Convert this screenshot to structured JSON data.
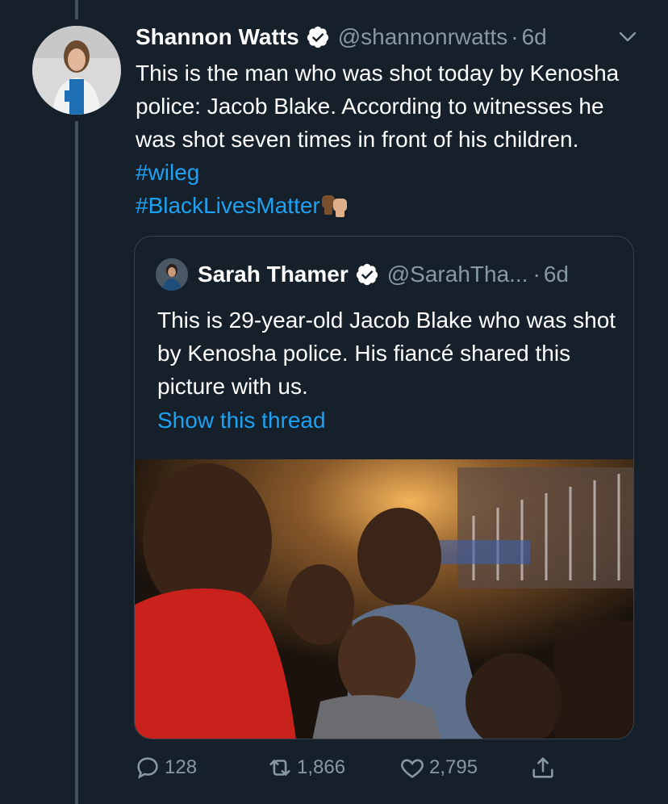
{
  "tweet": {
    "author_name": "Shannon Watts",
    "handle": "@shannonrwatts",
    "separator": "·",
    "time": "6d",
    "text_plain": "This is the man who was shot today by Kenosha police: Jacob Blake. According to witnesses he was shot seven times in front of his children.",
    "hashtag_1": "#wileg",
    "hashtag_2": "#BlackLivesMatter",
    "emoji": "raised-fists-emoji"
  },
  "quoted_tweet": {
    "author_name": "Sarah Thamer",
    "handle": "@SarahTha...",
    "separator": "·",
    "time": "6d",
    "text": "This is 29-year-old Jacob Blake who was shot by Kenosha police. His fiancé shared this picture with us.",
    "show_thread": "Show this thread"
  },
  "actions": {
    "replies": "128",
    "retweets": "1,866",
    "likes": "2,795"
  },
  "colors": {
    "background": "#15202b",
    "text": "#ffffff",
    "muted": "#8899a6",
    "link": "#1da1f2",
    "border": "#38444d"
  }
}
